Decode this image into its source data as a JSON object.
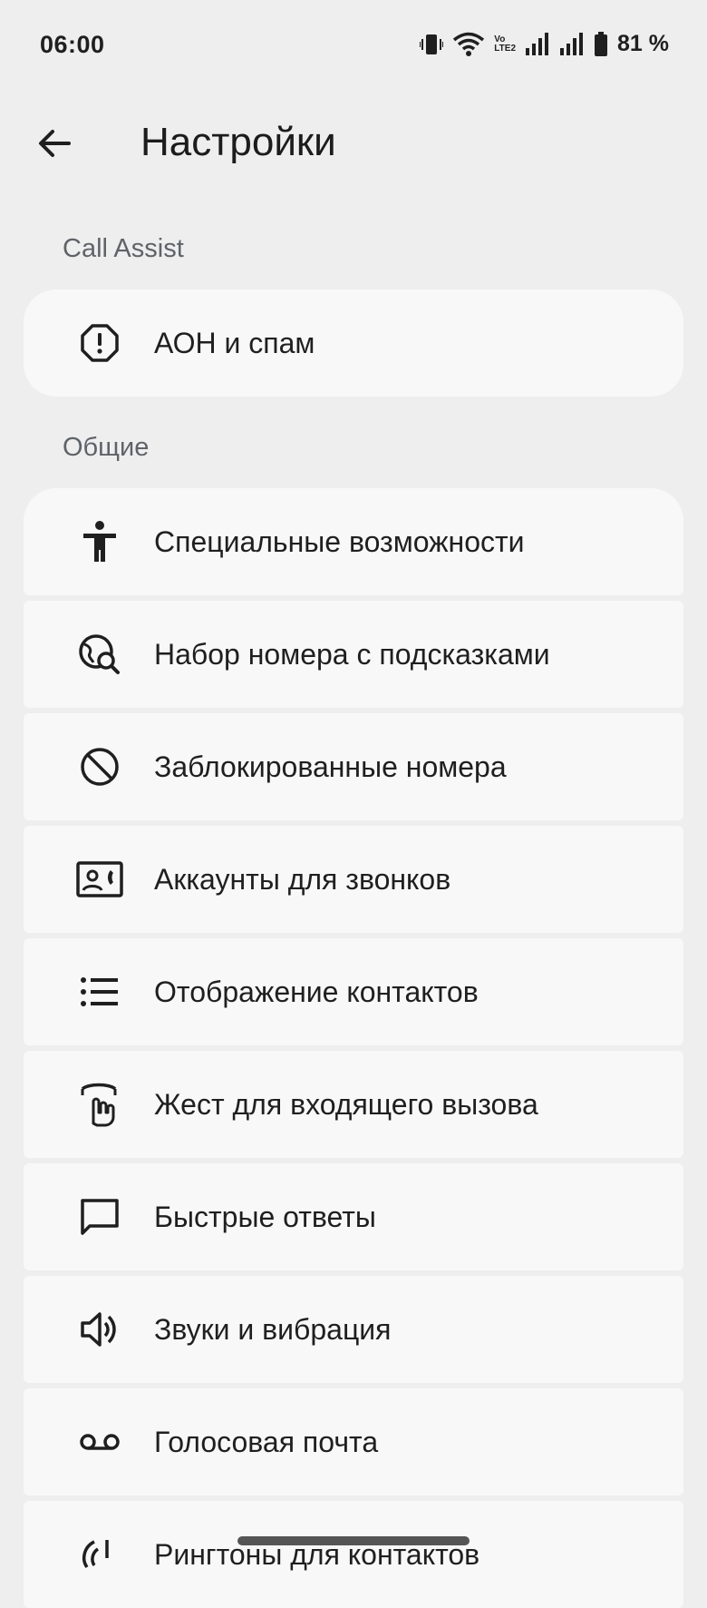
{
  "status": {
    "time": "06:00",
    "volte_top": "Vo",
    "volte_bottom": "LTE2",
    "battery": "81 %"
  },
  "header": {
    "title": "Настройки"
  },
  "sections": {
    "call_assist": "Call Assist",
    "general": "Общие"
  },
  "items": [
    {
      "label": "АОН и спам",
      "icon": "caller-id-spam-icon"
    },
    {
      "label": "Специальные возможности",
      "icon": "accessibility-icon"
    },
    {
      "label": "Набор номера с подсказками",
      "icon": "assisted-dialing-icon"
    },
    {
      "label": "Заблокированные номера",
      "icon": "block-icon"
    },
    {
      "label": "Аккаунты для звонков",
      "icon": "calling-accounts-icon"
    },
    {
      "label": "Отображение контактов",
      "icon": "list-icon"
    },
    {
      "label": "Жест для входящего вызова",
      "icon": "gesture-icon"
    },
    {
      "label": "Быстрые ответы",
      "icon": "chat-bubble-icon"
    },
    {
      "label": "Звуки и вибрация",
      "icon": "volume-icon"
    },
    {
      "label": "Голосовая почта",
      "icon": "voicemail-icon"
    },
    {
      "label": "Рингтоны для контактов",
      "icon": "ringtone-icon"
    }
  ]
}
